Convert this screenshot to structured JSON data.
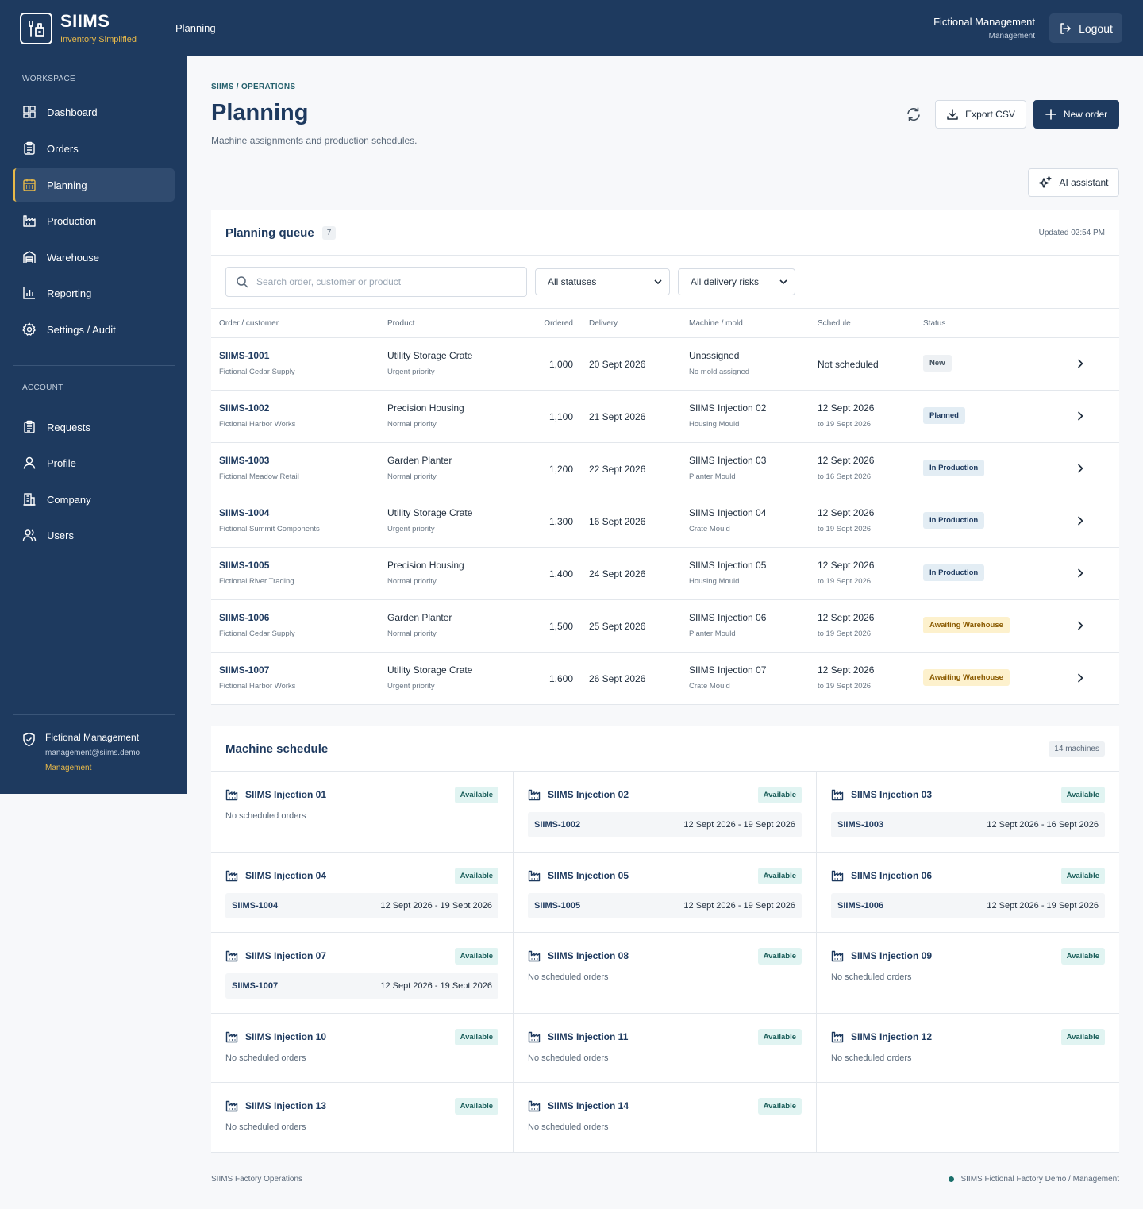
{
  "app": {
    "name": "SIIMS",
    "tagline": "Inventory Simplified",
    "section": "Planning"
  },
  "user": {
    "name": "Fictional Management",
    "role": "Management",
    "email": "management@siims.demo",
    "logout_label": "Logout"
  },
  "sidebar": {
    "workspace_label": "WORKSPACE",
    "workspace_items": [
      {
        "label": "Dashboard",
        "icon": "dashboard-icon"
      },
      {
        "label": "Orders",
        "icon": "clipboard-icon"
      },
      {
        "label": "Planning",
        "icon": "calendar-icon",
        "active": true
      },
      {
        "label": "Production",
        "icon": "factory-icon"
      },
      {
        "label": "Warehouse",
        "icon": "warehouse-icon"
      },
      {
        "label": "Reporting",
        "icon": "bar-chart-icon"
      },
      {
        "label": "Settings / Audit",
        "icon": "gear-icon"
      }
    ],
    "account_label": "ACCOUNT",
    "account_items": [
      {
        "label": "Requests",
        "icon": "clipboard-icon"
      },
      {
        "label": "Profile",
        "icon": "user-icon"
      },
      {
        "label": "Company",
        "icon": "building-icon"
      },
      {
        "label": "Users",
        "icon": "users-icon"
      }
    ]
  },
  "page": {
    "breadcrumb": "SIIMS / OPERATIONS",
    "title": "Planning",
    "subtitle": "Machine assignments and production schedules.",
    "export_label": "Export CSV",
    "new_order_label": "New order",
    "ai_label": "AI assistant"
  },
  "queue": {
    "title": "Planning queue",
    "count": "7",
    "updated": "Updated 02:54 PM",
    "search_placeholder": "Search order, customer or product",
    "status_filter": "All statuses",
    "risk_filter": "All delivery risks",
    "columns": [
      "Order / customer",
      "Product",
      "Ordered",
      "Delivery",
      "Machine / mold",
      "Schedule",
      "Status"
    ],
    "rows": [
      {
        "id": "SIIMS-1001",
        "customer": "Fictional Cedar Supply",
        "product": "Utility Storage Crate",
        "priority": "Urgent priority",
        "qty": "1,000",
        "delivery": "20 Sept 2026",
        "machine": "Unassigned",
        "mold": "No mold assigned",
        "sched_start": "Not scheduled",
        "sched_end": "",
        "status": "New",
        "status_kind": "new"
      },
      {
        "id": "SIIMS-1002",
        "customer": "Fictional Harbor Works",
        "product": "Precision Housing",
        "priority": "Normal priority",
        "qty": "1,100",
        "delivery": "21 Sept 2026",
        "machine": "SIIMS Injection 02",
        "mold": "Housing Mould",
        "sched_start": "12 Sept 2026",
        "sched_end": "to 19 Sept 2026",
        "status": "Planned",
        "status_kind": "blue"
      },
      {
        "id": "SIIMS-1003",
        "customer": "Fictional Meadow Retail",
        "product": "Garden Planter",
        "priority": "Normal priority",
        "qty": "1,200",
        "delivery": "22 Sept 2026",
        "machine": "SIIMS Injection 03",
        "mold": "Planter Mould",
        "sched_start": "12 Sept 2026",
        "sched_end": "to 16 Sept 2026",
        "status": "In Production",
        "status_kind": "blue"
      },
      {
        "id": "SIIMS-1004",
        "customer": "Fictional Summit Components",
        "product": "Utility Storage Crate",
        "priority": "Urgent priority",
        "qty": "1,300",
        "delivery": "16 Sept 2026",
        "machine": "SIIMS Injection 04",
        "mold": "Crate Mould",
        "sched_start": "12 Sept 2026",
        "sched_end": "to 19 Sept 2026",
        "status": "In Production",
        "status_kind": "blue"
      },
      {
        "id": "SIIMS-1005",
        "customer": "Fictional River Trading",
        "product": "Precision Housing",
        "priority": "Normal priority",
        "qty": "1,400",
        "delivery": "24 Sept 2026",
        "machine": "SIIMS Injection 05",
        "mold": "Housing Mould",
        "sched_start": "12 Sept 2026",
        "sched_end": "to 19 Sept 2026",
        "status": "In Production",
        "status_kind": "blue"
      },
      {
        "id": "SIIMS-1006",
        "customer": "Fictional Cedar Supply",
        "product": "Garden Planter",
        "priority": "Normal priority",
        "qty": "1,500",
        "delivery": "25 Sept 2026",
        "machine": "SIIMS Injection 06",
        "mold": "Planter Mould",
        "sched_start": "12 Sept 2026",
        "sched_end": "to 19 Sept 2026",
        "status": "Awaiting Warehouse",
        "status_kind": "amber"
      },
      {
        "id": "SIIMS-1007",
        "customer": "Fictional Harbor Works",
        "product": "Utility Storage Crate",
        "priority": "Urgent priority",
        "qty": "1,600",
        "delivery": "26 Sept 2026",
        "machine": "SIIMS Injection 07",
        "mold": "Crate Mould",
        "sched_start": "12 Sept 2026",
        "sched_end": "to 19 Sept 2026",
        "status": "Awaiting Warehouse",
        "status_kind": "amber"
      }
    ]
  },
  "schedule": {
    "title": "Machine schedule",
    "count_label": "14 machines",
    "empty_label": "No scheduled orders",
    "machines": [
      {
        "name": "SIIMS Injection 01",
        "status": "Available",
        "job_id": "",
        "job_dates": ""
      },
      {
        "name": "SIIMS Injection 02",
        "status": "Available",
        "job_id": "SIIMS-1002",
        "job_dates": "12 Sept 2026 - 19 Sept 2026"
      },
      {
        "name": "SIIMS Injection 03",
        "status": "Available",
        "job_id": "SIIMS-1003",
        "job_dates": "12 Sept 2026 - 16 Sept 2026"
      },
      {
        "name": "SIIMS Injection 04",
        "status": "Available",
        "job_id": "SIIMS-1004",
        "job_dates": "12 Sept 2026 - 19 Sept 2026"
      },
      {
        "name": "SIIMS Injection 05",
        "status": "Available",
        "job_id": "SIIMS-1005",
        "job_dates": "12 Sept 2026 - 19 Sept 2026"
      },
      {
        "name": "SIIMS Injection 06",
        "status": "Available",
        "job_id": "SIIMS-1006",
        "job_dates": "12 Sept 2026 - 19 Sept 2026"
      },
      {
        "name": "SIIMS Injection 07",
        "status": "Available",
        "job_id": "SIIMS-1007",
        "job_dates": "12 Sept 2026 - 19 Sept 2026"
      },
      {
        "name": "SIIMS Injection 08",
        "status": "Available",
        "job_id": "",
        "job_dates": ""
      },
      {
        "name": "SIIMS Injection 09",
        "status": "Available",
        "job_id": "",
        "job_dates": ""
      },
      {
        "name": "SIIMS Injection 10",
        "status": "Available",
        "job_id": "",
        "job_dates": ""
      },
      {
        "name": "SIIMS Injection 11",
        "status": "Available",
        "job_id": "",
        "job_dates": ""
      },
      {
        "name": "SIIMS Injection 12",
        "status": "Available",
        "job_id": "",
        "job_dates": ""
      },
      {
        "name": "SIIMS Injection 13",
        "status": "Available",
        "job_id": "",
        "job_dates": ""
      },
      {
        "name": "SIIMS Injection 14",
        "status": "Available",
        "job_id": "",
        "job_dates": ""
      }
    ]
  },
  "footer": {
    "left": "SIIMS Factory Operations",
    "right": "SIIMS Fictional Factory Demo / Management"
  },
  "colors": {
    "navy": "#1e3a5f",
    "accent": "#e8b949",
    "teal": "#1a6f6a"
  }
}
